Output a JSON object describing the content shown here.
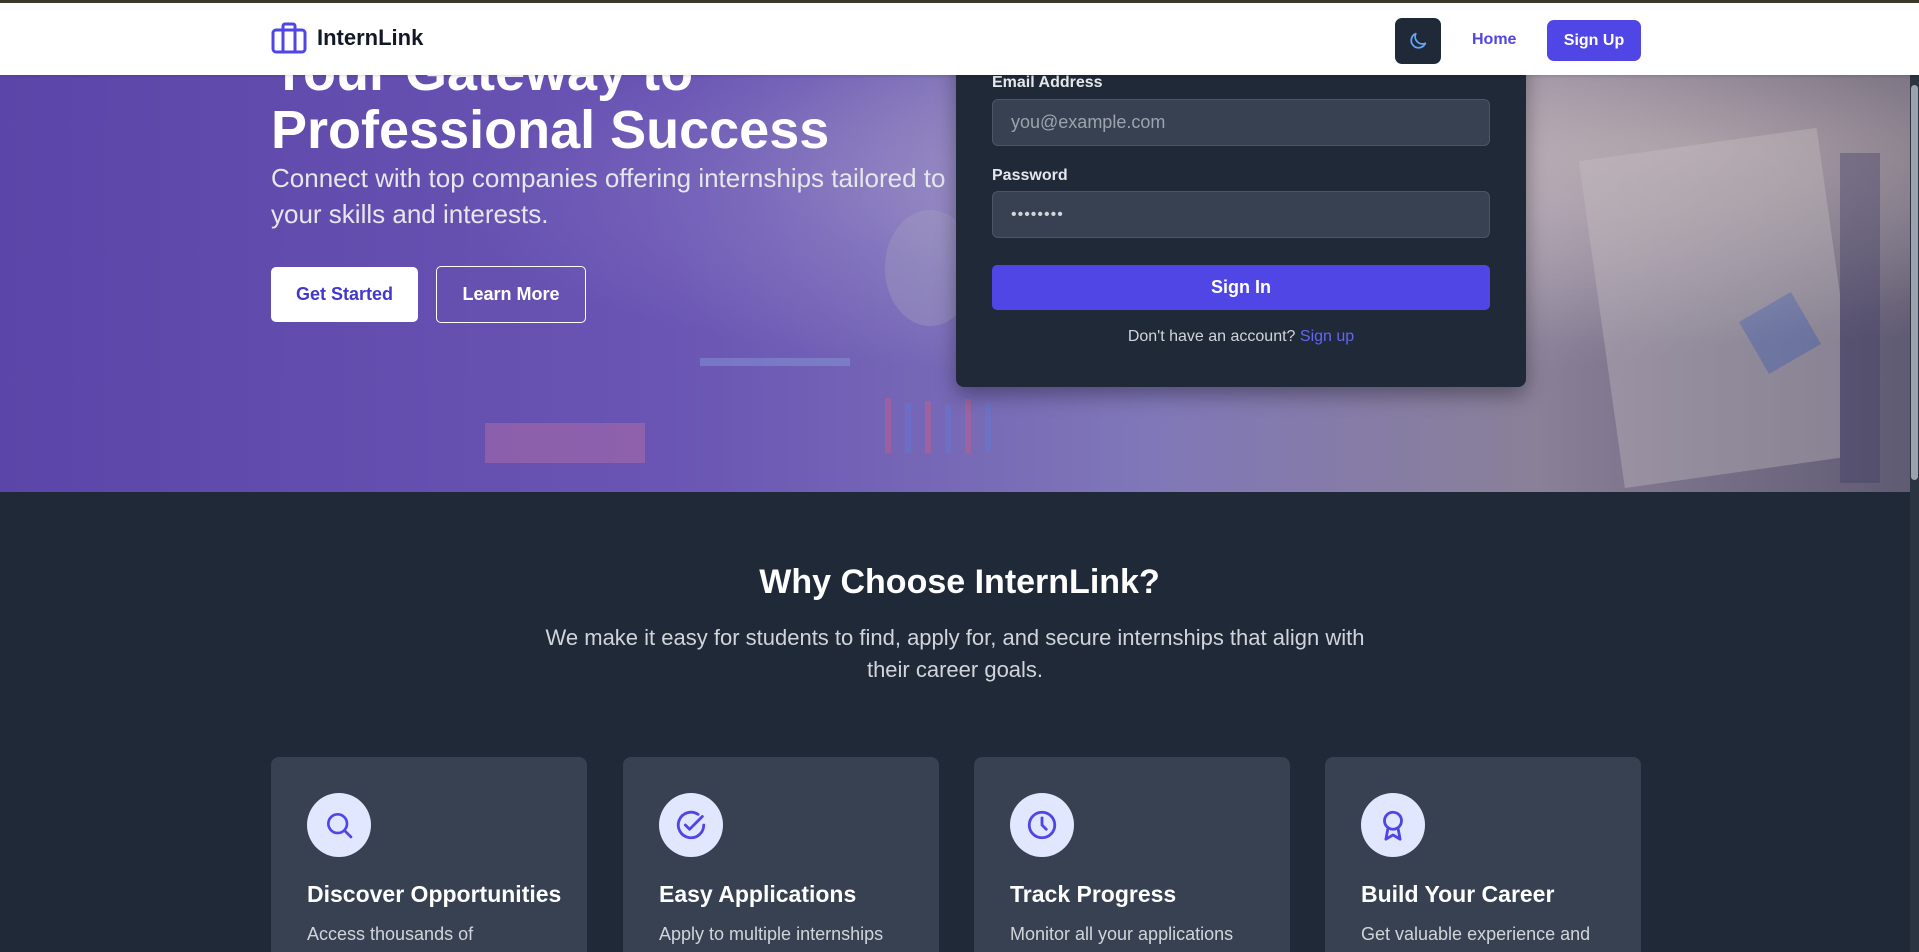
{
  "header": {
    "brand": "InternLink",
    "nav_home": "Home",
    "nav_signup": "Sign Up",
    "theme_icon": "moon-icon"
  },
  "hero": {
    "title_line1": "Your Gateway to",
    "title_line2": "Professional Success",
    "subtitle": "Connect with top companies offering internships tailored to your skills and interests.",
    "btn_start": "Get Started",
    "btn_learn": "Learn More"
  },
  "login": {
    "email_label": "Email Address",
    "email_placeholder": "you@example.com",
    "password_label": "Password",
    "password_value": "••••••••",
    "signin_label": "Sign In",
    "no_account_text": "Don't have an account?",
    "signup_link": "Sign up"
  },
  "features": {
    "title": "Why Choose InternLink?",
    "subtitle": "We make it easy for students to find, apply for, and secure internships that align with their career goals.",
    "cards": [
      {
        "icon": "search-icon",
        "title": "Discover Opportunities",
        "desc": "Access thousands of"
      },
      {
        "icon": "check-circle-icon",
        "title": "Easy Applications",
        "desc": "Apply to multiple internships"
      },
      {
        "icon": "clock-icon",
        "title": "Track Progress",
        "desc": "Monitor all your applications"
      },
      {
        "icon": "award-icon",
        "title": "Build Your Career",
        "desc": "Get valuable experience and"
      }
    ]
  },
  "colors": {
    "accent": "#4f46e5",
    "dark_bg": "#1f2937",
    "card_bg": "#374151"
  }
}
